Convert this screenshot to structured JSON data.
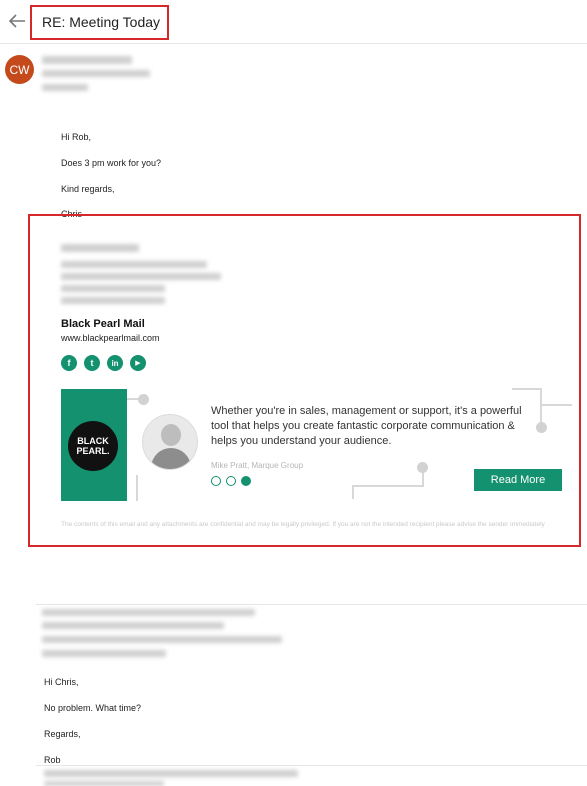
{
  "header": {
    "subject": "RE: Meeting Today",
    "back_icon": "arrow-left-icon"
  },
  "message1": {
    "sender_initials": "CW",
    "avatar_color": "#c44a1c",
    "greeting": "Hi Rob,",
    "line1": "Does 3 pm work for you?",
    "closing": "Kind regards,",
    "signoff": "Chris"
  },
  "signature": {
    "brand": "Black Pearl Mail",
    "url": "www.blackpearlmail.com",
    "social_icons": [
      "facebook-icon",
      "twitter-icon",
      "linkedin-icon",
      "youtube-icon"
    ],
    "social_glyphs": [
      "f",
      "t",
      "in",
      "▶"
    ],
    "logo_text": "BLACK PEARL.",
    "quote": "Whether you're in sales, management or support, it's a powerful tool that helps you create fantastic corporate communication & helps you understand your audience.",
    "quote_author": "Mike Pratt, Marque Group",
    "read_more": "Read More",
    "disclaimer": "The contents of this email and any attachments are confidential and may be legally privileged. If you are not the intended recipient please advise the sender immediately",
    "accent_color": "#14916f"
  },
  "message2": {
    "greeting": "Hi Chris,",
    "line1": "No problem. What time?",
    "closing": "Regards,",
    "signoff": "Rob"
  }
}
